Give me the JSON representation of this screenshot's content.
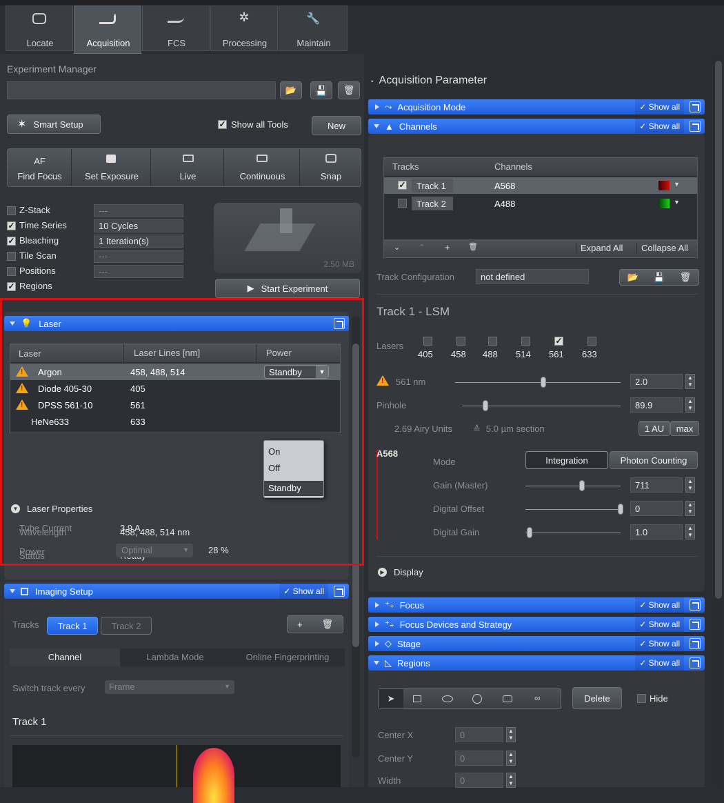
{
  "tabs": [
    {
      "label": "Locate",
      "icon": "locate-icon"
    },
    {
      "label": "Acquisition",
      "icon": "acquisition-icon"
    },
    {
      "label": "FCS",
      "icon": "fcs-icon"
    },
    {
      "label": "Processing",
      "icon": "processing-icon"
    },
    {
      "label": "Maintain",
      "icon": "maintain-icon"
    }
  ],
  "active_tab": "Acquisition",
  "experiment": {
    "title": "Experiment Manager",
    "name_value": "",
    "smart_setup": "Smart Setup",
    "show_all_tools": "Show all Tools",
    "new": "New"
  },
  "action_buttons": [
    {
      "top": "AF",
      "label": "Find Focus"
    },
    {
      "top": "",
      "label": "Set Exposure"
    },
    {
      "top": "",
      "label": "Live"
    },
    {
      "top": "",
      "label": "Continuous"
    },
    {
      "top": "",
      "label": "Snap"
    }
  ],
  "options": [
    {
      "label": "Z-Stack",
      "checked": false,
      "value": "---"
    },
    {
      "label": "Time Series",
      "checked": true,
      "value": "10 Cycles"
    },
    {
      "label": "Bleaching",
      "checked": true,
      "value": "1 Iteration(s)"
    },
    {
      "label": "Tile Scan",
      "checked": false,
      "value": "---"
    },
    {
      "label": "Positions",
      "checked": false,
      "value": "---"
    },
    {
      "label": "Regions",
      "checked": true,
      "value": ""
    }
  ],
  "preview_size": "2.50 MB",
  "start_experiment": "Start Experiment",
  "laser": {
    "title": "Laser",
    "headers": [
      "Laser",
      "Laser Lines [nm]",
      "Power"
    ],
    "rows": [
      {
        "name": "Argon",
        "lines": "458, 488, 514",
        "power": "Standby",
        "warn": true
      },
      {
        "name": "Diode 405-30",
        "lines": "405",
        "power": "",
        "warn": true
      },
      {
        "name": "DPSS 561-10",
        "lines": "561",
        "power": "",
        "warn": true
      },
      {
        "name": "HeNe633",
        "lines": "633",
        "power": "",
        "warn": false
      }
    ],
    "dropdown_options": [
      "On",
      "Off",
      "Standby"
    ],
    "properties_title": "Laser Properties",
    "properties": {
      "wavelength_label": "Wavelength",
      "wavelength": "458, 488, 514 nm",
      "status_label": "Status",
      "status": "Ready",
      "tube_label": "Tube Current",
      "tube": "3.9 A",
      "power_label": "Power",
      "power_mode": "Optimal",
      "power_pct": "28 %"
    }
  },
  "imaging": {
    "title": "Imaging Setup",
    "show_all": "Show all",
    "tracks_label": "Tracks",
    "track1": "Track 1",
    "track2": "Track 2",
    "modes": [
      "Channel",
      "Lambda Mode",
      "Online Fingerprinting"
    ],
    "switch_label": "Switch track every",
    "switch_value": "Frame",
    "track_heading": "Track 1"
  },
  "acq": {
    "title": "Acquisition Parameter",
    "bars": {
      "mode": "Acquisition Mode",
      "channels": "Channels",
      "focus": "Focus",
      "focus_devices": "Focus Devices and Strategy",
      "stage": "Stage",
      "regions": "Regions"
    },
    "show_all": "Show all",
    "tracks_header": "Tracks",
    "channels_header": "Channels",
    "tracks": [
      {
        "name": "Track 1",
        "channel": "A568",
        "checked": true,
        "color": "#c01010"
      },
      {
        "name": "Track 2",
        "channel": "A488",
        "checked": false,
        "color": "#20c020"
      }
    ],
    "expand_all": "Expand All",
    "collapse_all": "Collapse All",
    "track_config_label": "Track Configuration",
    "track_config_value": "not defined",
    "track_lsm_title": "Track 1 - LSM",
    "lasers_label": "Lasers",
    "laser_lines": [
      {
        "nm": "405",
        "checked": false
      },
      {
        "nm": "458",
        "checked": false
      },
      {
        "nm": "488",
        "checked": false
      },
      {
        "nm": "514",
        "checked": false
      },
      {
        "nm": "561",
        "checked": true
      },
      {
        "nm": "633",
        "checked": false
      }
    ],
    "laser_561_label": "561 nm",
    "laser_561_value": "2.0",
    "pinhole_label": "Pinhole",
    "pinhole_value": "89.9",
    "airy_text": "2.69 Airy Units",
    "section_text": "5.0 µm section",
    "au_btn": "1 AU",
    "max_btn": "max",
    "channel_name": "A568",
    "mode_label": "Mode",
    "mode_integration": "Integration",
    "mode_photon": "Photon Counting",
    "gain_label": "Gain (Master)",
    "gain_value": "711",
    "offset_label": "Digital Offset",
    "offset_value": "0",
    "dgain_label": "Digital Gain",
    "dgain_value": "1.0",
    "display_label": "Display",
    "delete_btn": "Delete",
    "hide_label": "Hide",
    "center_x_label": "Center X",
    "center_x": "0",
    "center_y_label": "Center Y",
    "center_y": "0",
    "width_label": "Width",
    "width": "0"
  }
}
